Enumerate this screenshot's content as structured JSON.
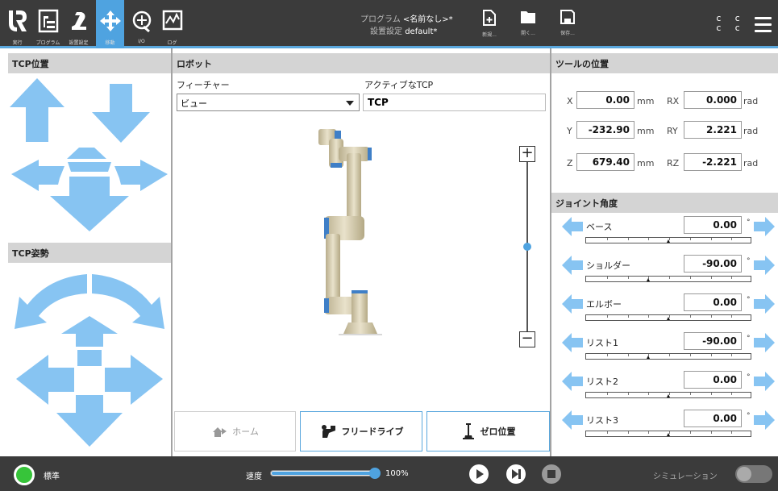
{
  "topbar": {
    "nav": [
      {
        "label": "実行",
        "icon": "ur-logo-icon"
      },
      {
        "label": "プログラム",
        "icon": "program-icon"
      },
      {
        "label": "設置設定",
        "icon": "installation-icon"
      },
      {
        "label": "移動",
        "icon": "move-icon",
        "active": true
      },
      {
        "label": "I/O",
        "icon": "io-icon"
      },
      {
        "label": "ログ",
        "icon": "log-icon"
      }
    ],
    "program_label": "プログラム",
    "program_value": "<名前なし>*",
    "install_label": "設置設定",
    "install_value": "default*",
    "file_buttons": [
      {
        "label": "新規...",
        "icon": "new-file-icon"
      },
      {
        "label": "開く...",
        "icon": "open-folder-icon"
      },
      {
        "label": "保存...",
        "icon": "save-icon"
      }
    ],
    "cc_top": "c c",
    "cc_bottom": "c c"
  },
  "tcp_position": {
    "title": "TCP位置"
  },
  "tcp_orientation": {
    "title": "TCP姿勢"
  },
  "robot": {
    "title": "ロボット",
    "feature_label": "フィーチャー",
    "feature_value": "ビュー",
    "active_tcp_label": "アクティブなTCP",
    "active_tcp_value": "TCP",
    "zoom_in": "+",
    "zoom_out": "−",
    "zoom_level": 0.5,
    "home_label": "ホーム",
    "freedrive_label": "フリードライブ",
    "zero_label": "ゼロ位置"
  },
  "tool_position": {
    "title": "ツールの位置",
    "rows": [
      {
        "axis": "X",
        "value": "0.00",
        "unit": "mm",
        "raxis": "RX",
        "rvalue": "0.000",
        "runit": "rad"
      },
      {
        "axis": "Y",
        "value": "-232.90",
        "unit": "mm",
        "raxis": "RY",
        "rvalue": "2.221",
        "runit": "rad"
      },
      {
        "axis": "Z",
        "value": "679.40",
        "unit": "mm",
        "raxis": "RZ",
        "rvalue": "-2.221",
        "runit": "rad"
      }
    ]
  },
  "joints": {
    "title": "ジョイント角度",
    "unit": "°",
    "items": [
      {
        "name": "ベース",
        "value": "0.00",
        "fraction": 0.5
      },
      {
        "name": "ショルダー",
        "value": "-90.00",
        "fraction": 0.375
      },
      {
        "name": "エルボー",
        "value": "0.00",
        "fraction": 0.5
      },
      {
        "name": "リスト1",
        "value": "-90.00",
        "fraction": 0.375
      },
      {
        "name": "リスト2",
        "value": "0.00",
        "fraction": 0.5
      },
      {
        "name": "リスト3",
        "value": "0.00",
        "fraction": 0.5
      }
    ]
  },
  "footer": {
    "status": "標準",
    "speed_label": "速度",
    "speed_value": "100%",
    "speed_fraction": 1.0,
    "simulation_label": "シミュレーション"
  },
  "colors": {
    "accent": "#5aa7dd",
    "arrow": "#87c4f2",
    "bar": "#3b3b3b",
    "status_green": "#37c43a"
  }
}
